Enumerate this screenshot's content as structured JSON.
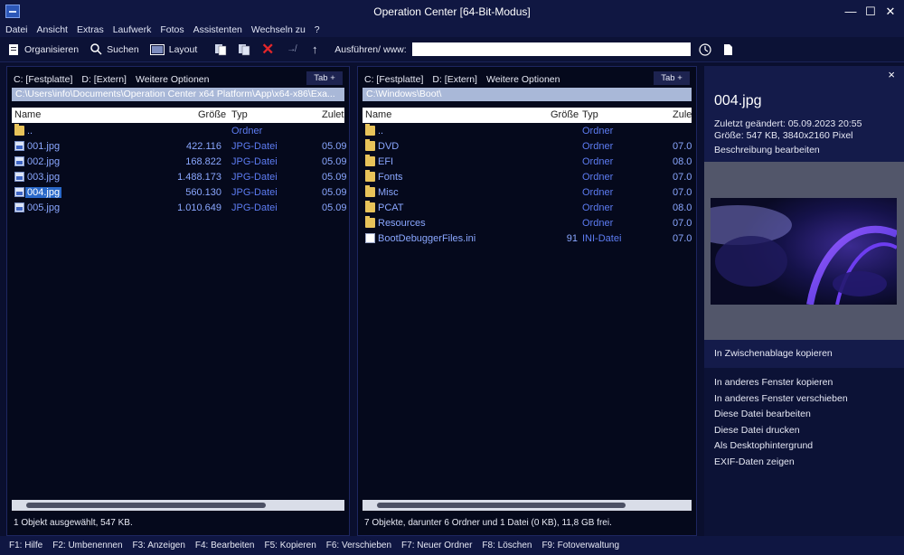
{
  "window": {
    "title": "Operation Center [64-Bit-Modus]"
  },
  "menu": [
    "Datei",
    "Ansicht",
    "Extras",
    "Laufwerk",
    "Fotos",
    "Assistenten",
    "Wechseln zu",
    "?"
  ],
  "toolbar": {
    "organize": "Organisieren",
    "search": "Suchen",
    "layout": "Layout",
    "run_label": "Ausführen/ www:",
    "run_value": ""
  },
  "left": {
    "drives": [
      "C: [Festplatte]",
      "D: [Extern]",
      "Weitere Optionen"
    ],
    "tab": "Tab +",
    "path": "C:\\Users\\info\\Documents\\Operation Center x64 Platform\\App\\x64-x86\\Exa...",
    "columns": {
      "name": "Name",
      "size": "Größe",
      "type": "Typ",
      "date": "Zulet"
    },
    "rows": [
      {
        "name": "..",
        "size": "",
        "type": "Ordner",
        "date": ""
      },
      {
        "name": "001.jpg",
        "size": "422.116",
        "type": "JPG-Datei",
        "date": "05.09"
      },
      {
        "name": "002.jpg",
        "size": "168.822",
        "type": "JPG-Datei",
        "date": "05.09"
      },
      {
        "name": "003.jpg",
        "size": "1.488.173",
        "type": "JPG-Datei",
        "date": "05.09"
      },
      {
        "name": "004.jpg",
        "size": "560.130",
        "type": "JPG-Datei",
        "date": "05.09"
      },
      {
        "name": "005.jpg",
        "size": "1.010.649",
        "type": "JPG-Datei",
        "date": "05.09"
      }
    ],
    "status": "1 Objekt ausgewählt, 547 KB."
  },
  "right": {
    "drives": [
      "C: [Festplatte]",
      "D: [Extern]",
      "Weitere Optionen"
    ],
    "tab": "Tab +",
    "path": "C:\\Windows\\Boot\\",
    "columns": {
      "name": "Name",
      "size": "Größe",
      "type": "Typ",
      "date": "Zule"
    },
    "rows": [
      {
        "name": "..",
        "size": "",
        "type": "Ordner",
        "date": ""
      },
      {
        "name": "DVD",
        "size": "",
        "type": "Ordner",
        "date": "07.0"
      },
      {
        "name": "EFI",
        "size": "",
        "type": "Ordner",
        "date": "08.0"
      },
      {
        "name": "Fonts",
        "size": "",
        "type": "Ordner",
        "date": "07.0"
      },
      {
        "name": "Misc",
        "size": "",
        "type": "Ordner",
        "date": "07.0"
      },
      {
        "name": "PCAT",
        "size": "",
        "type": "Ordner",
        "date": "08.0"
      },
      {
        "name": "Resources",
        "size": "",
        "type": "Ordner",
        "date": "07.0"
      },
      {
        "name": "BootDebuggerFiles.ini",
        "size": "91",
        "type": "INI-Datei",
        "date": "07.0"
      }
    ],
    "status": "7 Objekte, darunter 6 Ordner und 1 Datei (0 KB), 11,8 GB frei."
  },
  "preview": {
    "close": "×",
    "filename": "004.jpg",
    "modified": "Zuletzt geändert: 05.09.2023 20:55",
    "size": "Größe: 547 KB, 3840x2160 Pixel",
    "edit_desc": "Beschreibung bearbeiten",
    "copy_clipboard": "In Zwischenablage kopieren",
    "actions": [
      "In anderes Fenster kopieren",
      "In anderes Fenster verschieben",
      "Diese Datei bearbeiten",
      "Diese Datei drucken",
      "Als Desktophintergrund",
      "EXIF-Daten zeigen"
    ]
  },
  "fkeys": [
    "F1: Hilfe",
    "F2: Umbenennen",
    "F3: Anzeigen",
    "F4: Bearbeiten",
    "F5: Kopieren",
    "F6: Verschieben",
    "F7: Neuer Ordner",
    "F8: Löschen",
    "F9: Fotoverwaltung"
  ]
}
